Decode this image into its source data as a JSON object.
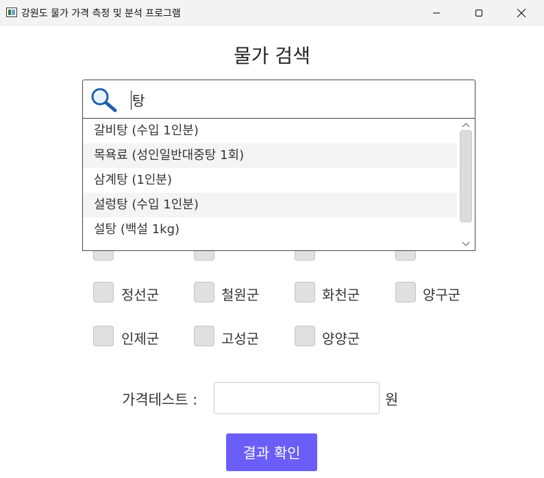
{
  "window": {
    "title": "강원도 물가 가격 측정 및 분석 프로그램"
  },
  "page": {
    "title": "물가 검색"
  },
  "search": {
    "query": "탕"
  },
  "suggestions": [
    "갈비탕 (수입 1인분)",
    "목욕료 (성인일반대중탕 1회)",
    "삼계탕 (1인분)",
    "설렁탕 (수입 1인분)",
    "설탕 (백설 1kg)"
  ],
  "regions": {
    "hidden_row": [
      "",
      "",
      "",
      ""
    ],
    "row2": [
      "정선군",
      "철원군",
      "화천군",
      "양구군"
    ],
    "row3": [
      "인제군",
      "고성군",
      "양양군"
    ]
  },
  "price": {
    "label": "가격테스트 :",
    "value": "",
    "unit": "원"
  },
  "confirm": {
    "label": "결과 확인"
  },
  "colors": {
    "accent": "#6b5ef8"
  }
}
